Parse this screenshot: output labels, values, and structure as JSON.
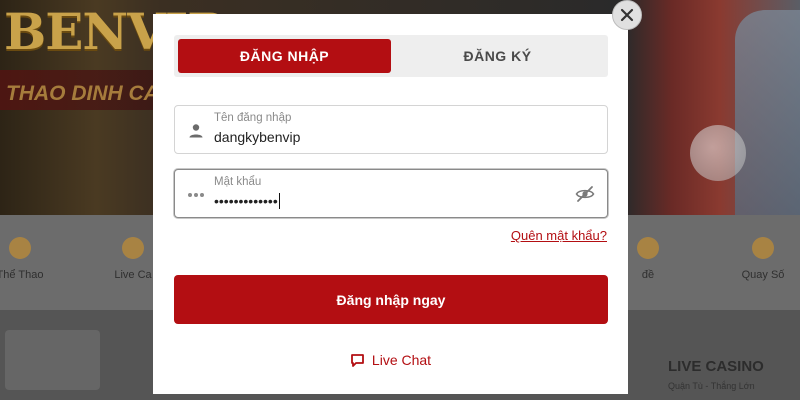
{
  "background": {
    "logo_text": "BENVIP",
    "tagline": "THAO DINH CA",
    "nav_items": [
      {
        "label": "Thể Thao"
      },
      {
        "label": "Live Ca"
      },
      {
        "label": "đề"
      },
      {
        "label": "Quay Số"
      }
    ],
    "live_section_title": "LIVE CASINO",
    "live_section_sub": "Quận Tù - Thắng Lớn"
  },
  "modal": {
    "close_icon": "close-icon",
    "tabs": [
      {
        "label": "ĐĂNG NHẬP",
        "active": true
      },
      {
        "label": "ĐĂNG KÝ",
        "active": false
      }
    ],
    "username": {
      "label": "Tên đăng nhập",
      "value": "dangkybenvip",
      "icon": "user-icon"
    },
    "password": {
      "label": "Mật khẩu",
      "value": "•••••••••••••",
      "icon": "dots-icon",
      "toggle_icon": "eye-off-icon"
    },
    "forgot_password": "Quên mật khẩu?",
    "submit_label": "Đăng nhập ngay",
    "live_chat": {
      "label": "Live Chat",
      "icon": "chat-icon"
    },
    "accent_color": "#b30e12"
  }
}
